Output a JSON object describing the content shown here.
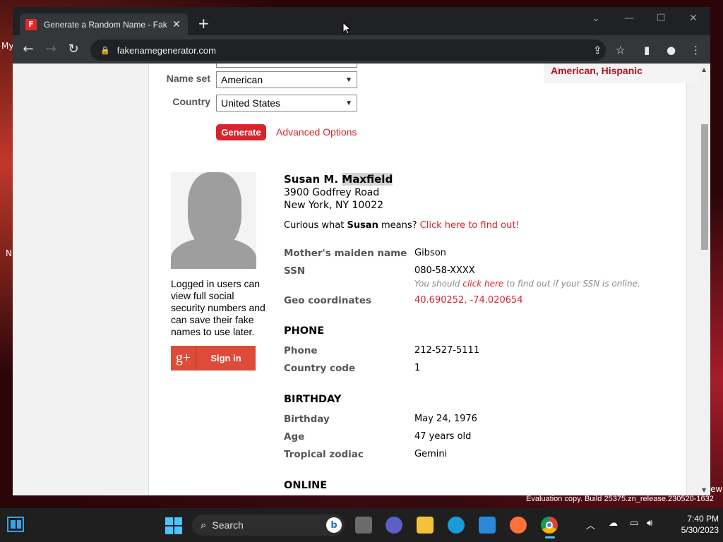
{
  "browser": {
    "tab_title": "Generate a Random Name - Fake",
    "tab_favicon": "F",
    "url": "fakenamegenerator.com",
    "icons": [
      "back-icon",
      "forward-icon",
      "reload-icon",
      "lock-icon",
      "share-icon",
      "star-icon",
      "sidepanel-icon",
      "profile-icon",
      "menu-icon"
    ]
  },
  "desktop": {
    "label_1": "My",
    "label_2": "N",
    "label_3": "ew"
  },
  "form": {
    "nameset_label": "Name set",
    "nameset_value": "American",
    "country_label": "Country",
    "country_value": "United States",
    "generate_label": "Generate",
    "advanced_label": "Advanced Options",
    "infobox_red_1": "American",
    "infobox_sep": ", ",
    "infobox_red_2": "Hispanic"
  },
  "sidebar": {
    "note": "Logged in users can view full social security numbers and can save their fake names to use later.",
    "gplus_icon": "g+",
    "signin_label": "Sign in"
  },
  "person": {
    "name_first": "Susan M. ",
    "name_last": "Maxfield",
    "address_1": "3900 Godfrey Road",
    "address_2": "New York, NY 10022",
    "curious_pre": "Curious what ",
    "curious_name": "Susan",
    "curious_mid": " means? ",
    "curious_link": "Click here to find out!",
    "maiden_label": "Mother's maiden name",
    "maiden_value": "Gibson",
    "ssn_label": "SSN",
    "ssn_value": "080-58-XXXX",
    "ssn_note_pre": "You should ",
    "ssn_note_link": "click here",
    "ssn_note_post": " to find out if your SSN is online.",
    "geo_label": "Geo coordinates",
    "geo_value": "40.690252, -74.020654",
    "phone_heading": "PHONE",
    "phone_label": "Phone",
    "phone_value": "212-527-5111",
    "country_code_label": "Country code",
    "country_code_value": "1",
    "birthday_heading": "BIRTHDAY",
    "birthday_label": "Birthday",
    "birthday_value": "May 24, 1976",
    "age_label": "Age",
    "age_value": "47 years old",
    "zodiac_label": "Tropical zodiac",
    "zodiac_value": "Gemini",
    "online_heading": "ONLINE"
  },
  "taskbar": {
    "search_label": "Search",
    "time": "7:40 PM",
    "date": "5/30/2023",
    "watermark": "Evaluation copy. Build 25375.zn_release.230520-1632"
  },
  "colors": {
    "accent_red": "#d9232d",
    "browser_dark": "#202124",
    "taskbar": "#1f1f1f"
  }
}
